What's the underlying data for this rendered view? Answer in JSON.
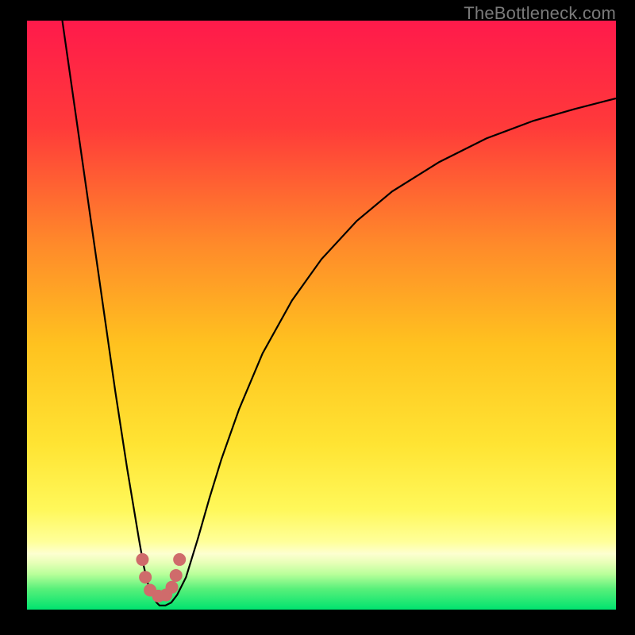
{
  "watermark": "TheBottleneck.com",
  "chart_data": {
    "type": "line",
    "title": "",
    "xlabel": "",
    "ylabel": "",
    "xlim": [
      0,
      100
    ],
    "ylim": [
      0,
      100
    ],
    "grid": false,
    "legend": false,
    "background_gradient": {
      "stops": [
        {
          "offset": 0.0,
          "color": "#ff1a4b"
        },
        {
          "offset": 0.18,
          "color": "#ff3a3a"
        },
        {
          "offset": 0.38,
          "color": "#ff8a2a"
        },
        {
          "offset": 0.55,
          "color": "#ffc21f"
        },
        {
          "offset": 0.72,
          "color": "#ffe433"
        },
        {
          "offset": 0.83,
          "color": "#fff85a"
        },
        {
          "offset": 0.885,
          "color": "#ffff9a"
        },
        {
          "offset": 0.905,
          "color": "#fdffd0"
        },
        {
          "offset": 0.92,
          "color": "#e8ffb8"
        },
        {
          "offset": 0.94,
          "color": "#b8ff9a"
        },
        {
          "offset": 0.965,
          "color": "#58f07a"
        },
        {
          "offset": 1.0,
          "color": "#00e36f"
        }
      ]
    },
    "series": [
      {
        "name": "bottleneck-curve",
        "color": "#000000",
        "width": 2.2,
        "x": [
          6.0,
          7.0,
          8.0,
          9.0,
          10.0,
          11.0,
          12.0,
          13.0,
          14.0,
          15.0,
          16.0,
          17.0,
          18.0,
          19.0,
          19.8,
          20.5,
          21.3,
          22.0,
          22.5,
          23.5,
          24.5,
          25.5,
          27.0,
          29.0,
          31.0,
          33.0,
          36.0,
          40.0,
          45.0,
          50.0,
          56.0,
          62.0,
          70.0,
          78.0,
          86.0,
          93.0,
          100.0
        ],
        "y": [
          100.0,
          93.0,
          86.0,
          79.0,
          72.0,
          65.0,
          58.0,
          51.0,
          44.0,
          37.0,
          30.5,
          24.0,
          18.0,
          12.0,
          7.5,
          4.5,
          2.5,
          1.2,
          0.7,
          0.7,
          1.2,
          2.5,
          5.5,
          12.0,
          19.0,
          25.5,
          34.0,
          43.5,
          52.5,
          59.5,
          66.0,
          71.0,
          76.0,
          80.0,
          83.0,
          85.0,
          86.8
        ]
      }
    ],
    "markers": {
      "name": "optimal-range",
      "color": "#cf6b6b",
      "radius": 8,
      "points": [
        {
          "x": 19.6,
          "y": 8.5
        },
        {
          "x": 20.1,
          "y": 5.5
        },
        {
          "x": 20.9,
          "y": 3.3
        },
        {
          "x": 22.3,
          "y": 2.3
        },
        {
          "x": 23.6,
          "y": 2.5
        },
        {
          "x": 24.6,
          "y": 3.8
        },
        {
          "x": 25.3,
          "y": 5.8
        },
        {
          "x": 25.9,
          "y": 8.5
        }
      ]
    }
  }
}
